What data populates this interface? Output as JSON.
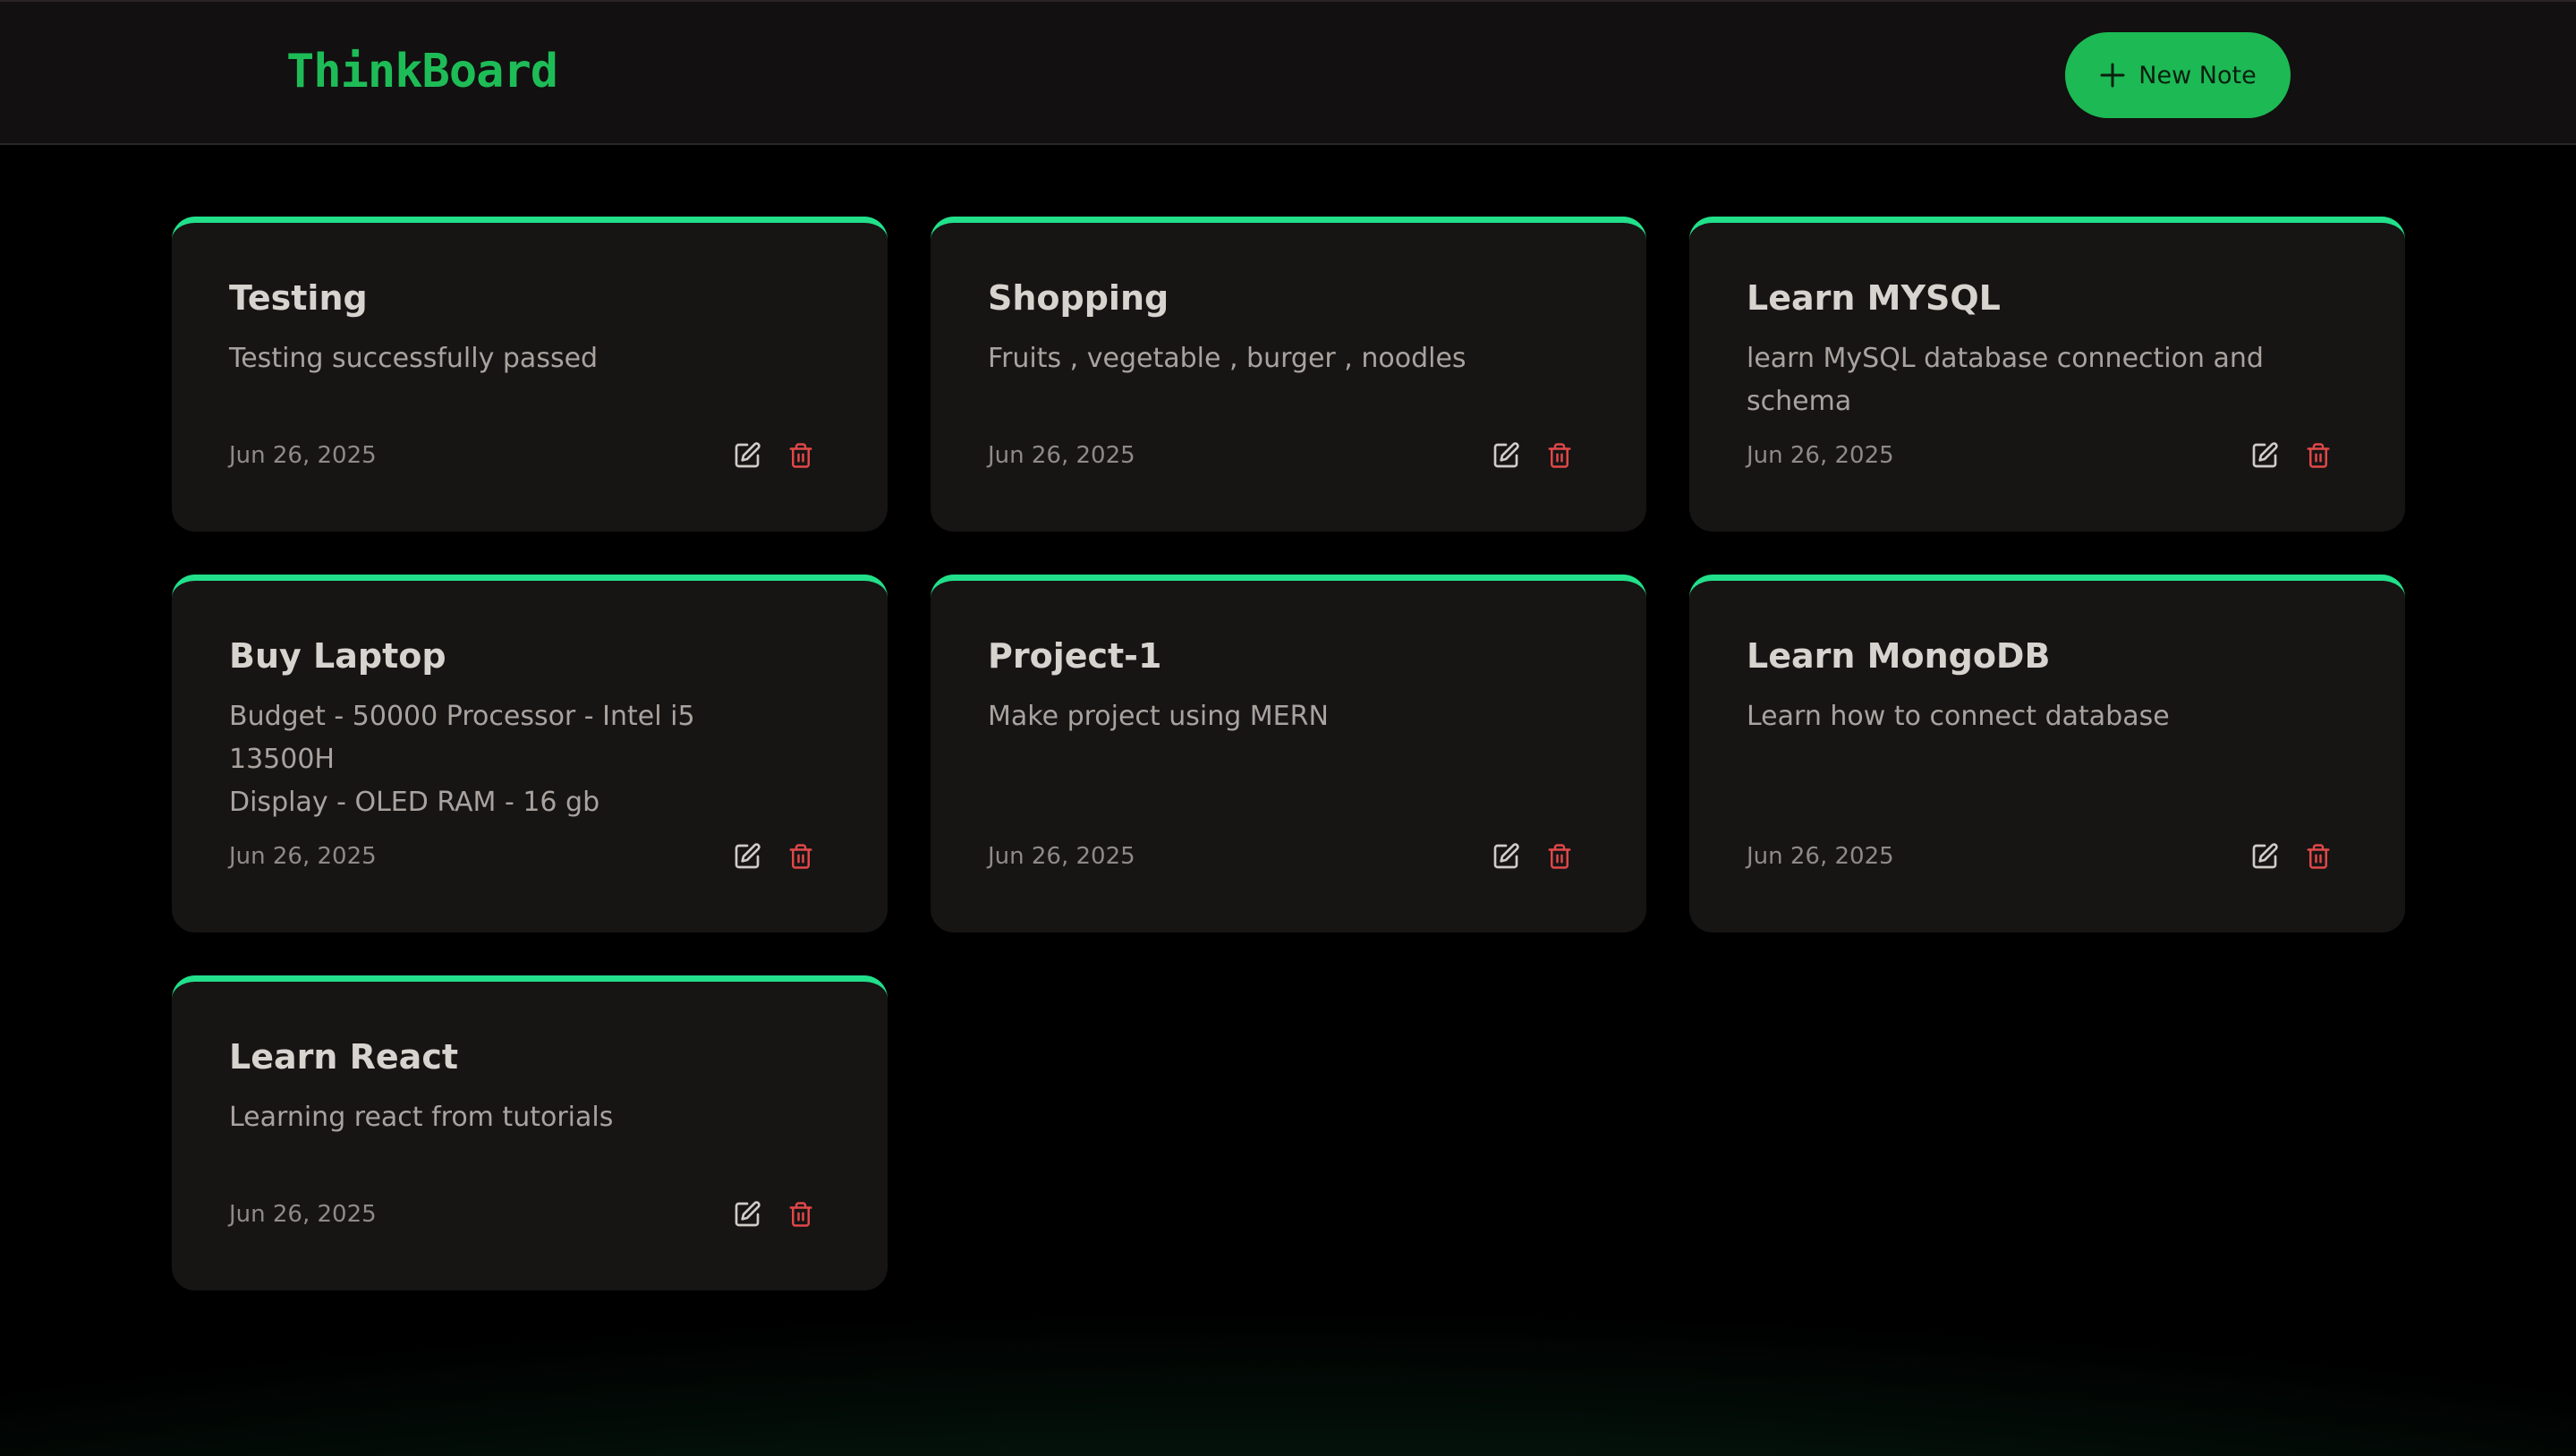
{
  "app": {
    "logo": "ThinkBoard",
    "new_note_label": "New Note"
  },
  "notes": [
    {
      "title": "Testing",
      "content": "Testing successfully passed",
      "date": "Jun 26, 2025"
    },
    {
      "title": "Shopping",
      "content": "Fruits , vegetable , burger , noodles",
      "date": "Jun 26, 2025"
    },
    {
      "title": "Learn MYSQL",
      "content": "learn MySQL database connection and schema",
      "date": "Jun 26, 2025"
    },
    {
      "title": "Buy Laptop",
      "content": "Budget - 50000 Processor - Intel i5 13500H\nDisplay - OLED RAM - 16 gb",
      "date": "Jun 26, 2025"
    },
    {
      "title": "Project-1",
      "content": "Make project using MERN",
      "date": "Jun 26, 2025"
    },
    {
      "title": "Learn MongoDB",
      "content": "Learn how to connect database",
      "date": "Jun 26, 2025"
    },
    {
      "title": "Learn React",
      "content": "Learning react from tutorials",
      "date": "Jun 26, 2025"
    }
  ],
  "icons": {
    "edit": "edit-icon",
    "delete": "trash-icon",
    "add": "plus-icon"
  },
  "colors": {
    "accent": "#1db954",
    "card_border": "#22e08a",
    "delete": "#e04848"
  }
}
